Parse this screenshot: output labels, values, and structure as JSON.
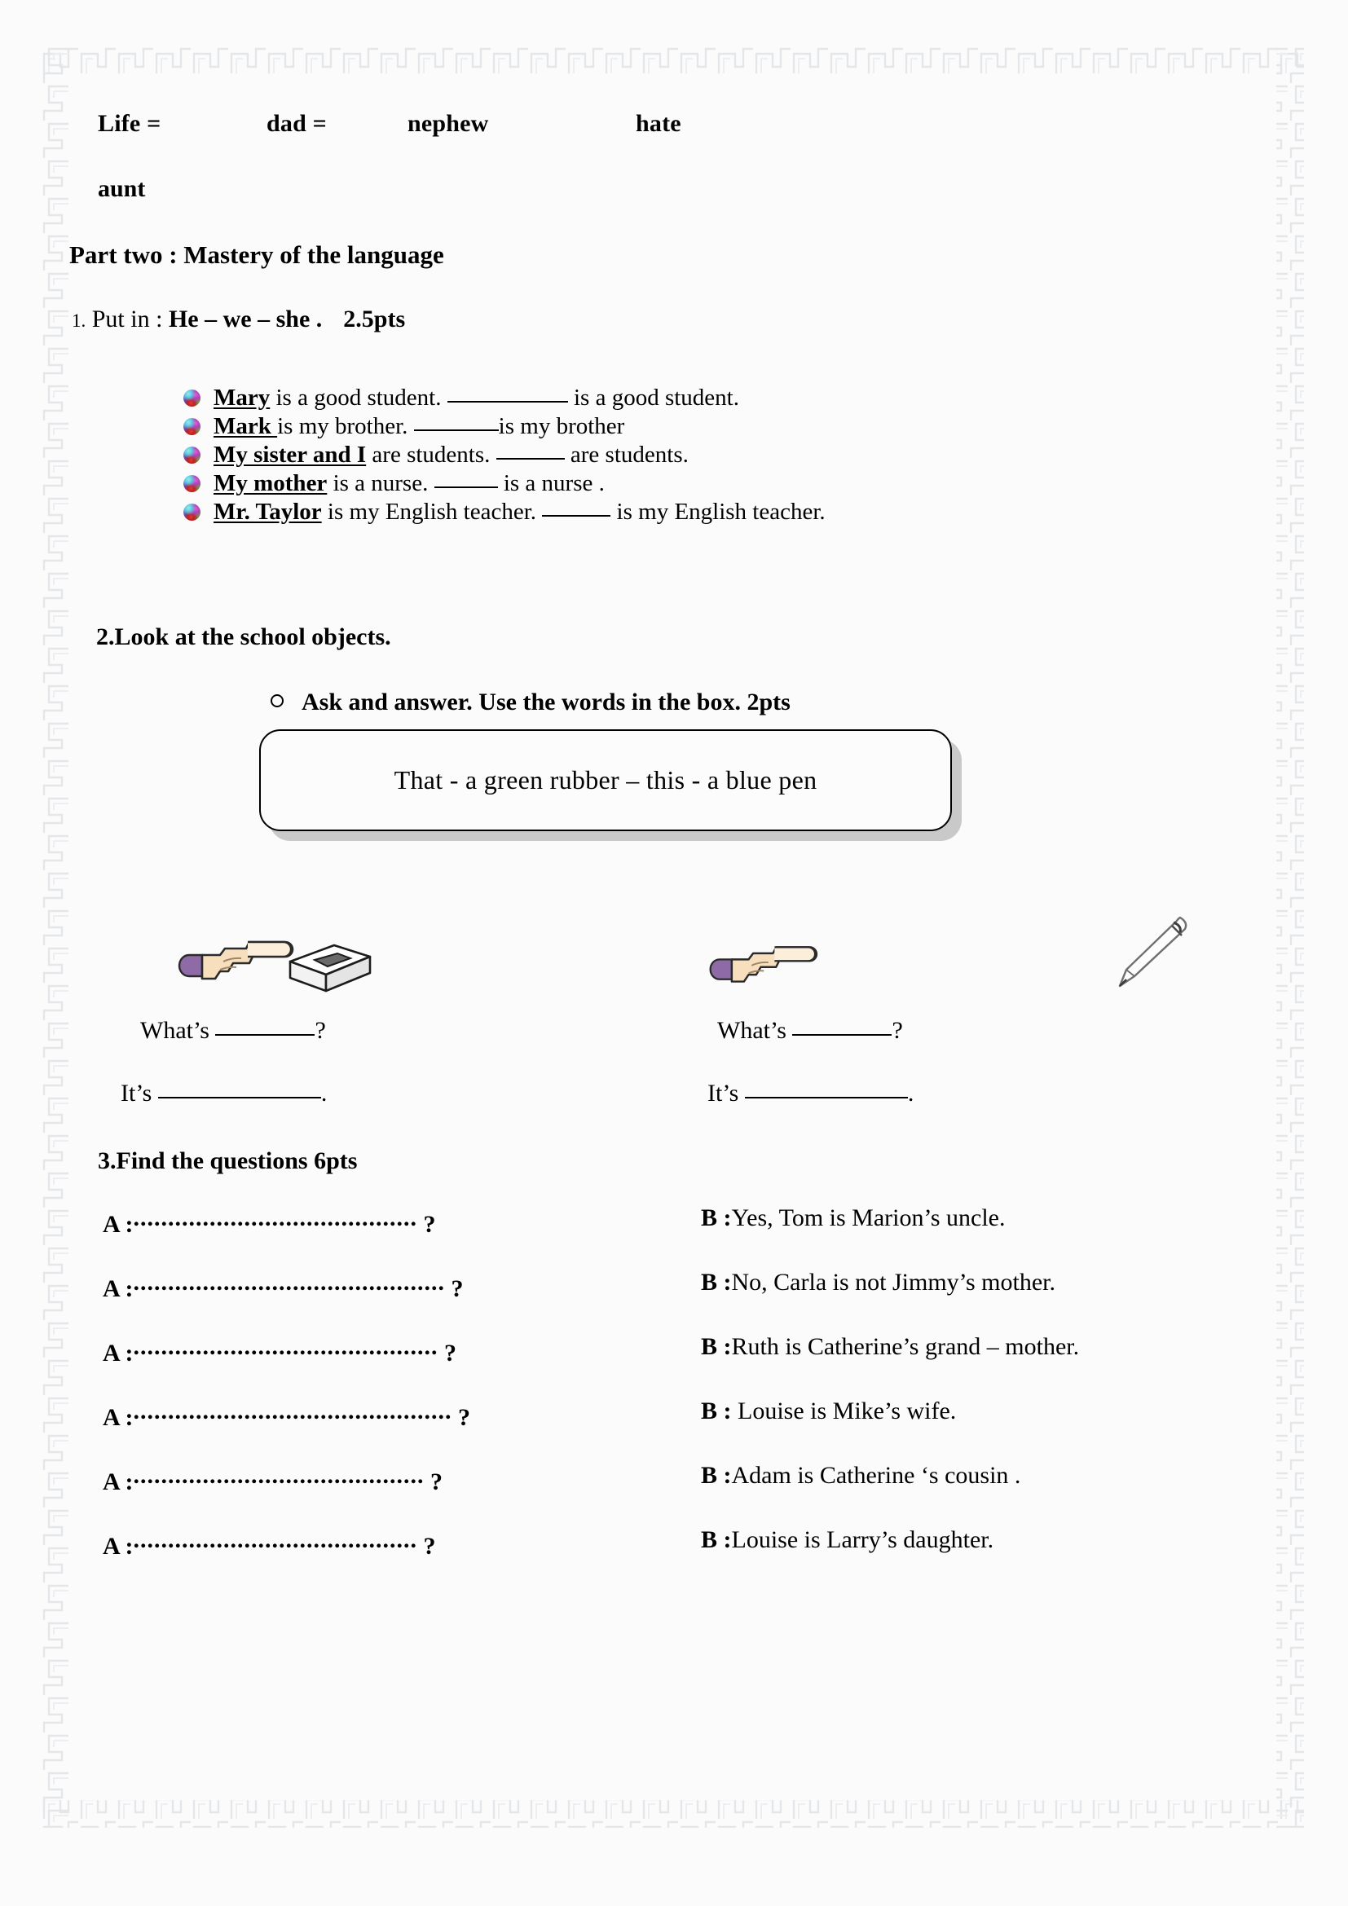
{
  "vocab_row": {
    "word1": "Life =",
    "word2": "dad =",
    "word3": "nephew",
    "word4": "hate",
    "word5": "aunt"
  },
  "part_title": "Part two : Mastery of the language",
  "task1": {
    "number": "1.",
    "lead": "Put in : ",
    "prompt": "He – we – she .",
    "points": "2.5pts",
    "items": [
      {
        "subject": "Mary",
        "mid": " is a good student.",
        "tail": " is a good student.",
        "blank": "b-xl"
      },
      {
        "subject": "Mark ",
        "mid": "is my brother.",
        "tail": "is my brother",
        "blank": "b-lg"
      },
      {
        "subject": "My sister and I",
        "mid": " are students.",
        "tail": " are students.",
        "blank": "b-md"
      },
      {
        "subject": "My mother",
        "mid": " is a nurse.",
        "tail": " is a nurse .",
        "blank": "b-sm"
      },
      {
        "subject": "Mr. Taylor",
        "mid": " is my English teacher.",
        "tail": " is my English teacher.",
        "blank": "b-md"
      }
    ]
  },
  "task2": {
    "heading": "2.Look at the school objects.",
    "subheading": "Ask and answer. Use the words in the box.  2pts",
    "wordbox": "That -  a green rubber   – this -  a blue pen",
    "left_question": "What’s",
    "left_question_end": "?",
    "left_answer": "It’s",
    "left_answer_end": ".",
    "right_question": "What’s",
    "right_question_end": "?",
    "right_answer": "It’s",
    "right_answer_end": ".",
    "icons": {
      "hand_pointer": "pointing-hand-icon",
      "eraser": "eraser-icon",
      "pen": "pen-icon"
    }
  },
  "task3": {
    "heading": "3.Find the questions   6pts",
    "a_label": "A :",
    "question_mark": "?",
    "rows": [
      {
        "dots": 41,
        "answer_label": "B :",
        "answer": "Yes, Tom is Marion’s uncle."
      },
      {
        "dots": 45,
        "answer_label": "B :",
        "answer": "No, Carla is not Jimmy’s mother."
      },
      {
        "dots": 44,
        "answer_label": "B :",
        "answer": "Ruth is Catherine’s grand – mother."
      },
      {
        "dots": 46,
        "answer_label": "B : ",
        "answer": "Louise is Mike’s wife."
      },
      {
        "dots": 42,
        "answer_label": "B :",
        "answer": "Adam is Catherine ‘s cousin ."
      },
      {
        "dots": 41,
        "answer_label": "B :",
        "answer": "Louise is Larry’s daughter."
      }
    ]
  },
  "colors": {
    "page_background": "#fbfbfb",
    "border_pattern": "#e8e9ec",
    "text": "#000000",
    "box_shadow": "#c9c9c9"
  }
}
